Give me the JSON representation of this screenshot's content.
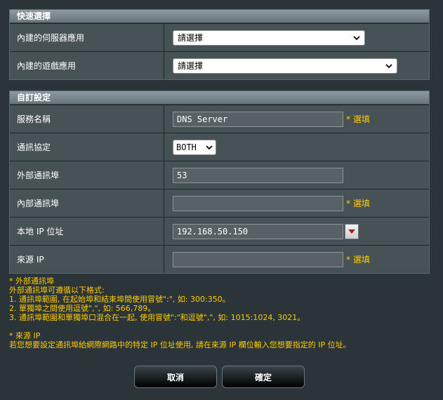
{
  "quick_select": {
    "header": "快速選擇",
    "rows": [
      {
        "label": "內建的伺服器應用",
        "value": "請選擇"
      },
      {
        "label": "內建的遊戲應用",
        "value": "請選擇"
      }
    ]
  },
  "custom": {
    "header": "自訂設定",
    "service_name": {
      "label": "服務名稱",
      "value": "DNS Server",
      "hint": "* 選填"
    },
    "protocol": {
      "label": "通訊協定",
      "value": "BOTH"
    },
    "external_port": {
      "label": "外部通訊埠",
      "value": "53"
    },
    "internal_port": {
      "label": "內部通訊埠",
      "value": "",
      "hint": "* 選填"
    },
    "local_ip": {
      "label": "本地 IP 位址",
      "value": "192.168.50.150"
    },
    "source_ip": {
      "label": "來源 IP",
      "value": "",
      "hint": "* 選填"
    }
  },
  "notes": {
    "ext_title": "* 外部通訊埠",
    "ext_line1": "外部通訊埠可遵循以下格式:",
    "ext_line2": "1. 通訊埠範圍, 在起始埠和結束埠間使用冒號\":\", 如: 300:350。",
    "ext_line3": "2. 單獨埠之間使用逗號\",\", 如: 566,789。",
    "ext_line4": "3. 通訊埠範圍和單獨埠口混合在一起, 使用冒號\":\"和逗號\",\", 如: 1015:1024, 3021。",
    "src_title": "* 來源 IP",
    "src_line1": "若您想要設定通訊埠給網際網路中的特定 IP 位址使用, 請在來源 IP 欄位輸入您想要指定的 IP 位址。"
  },
  "buttons": {
    "cancel": "取消",
    "ok": "確定"
  },
  "colors": {
    "accent_text": "#ffcc00",
    "background": "#2b3438"
  }
}
